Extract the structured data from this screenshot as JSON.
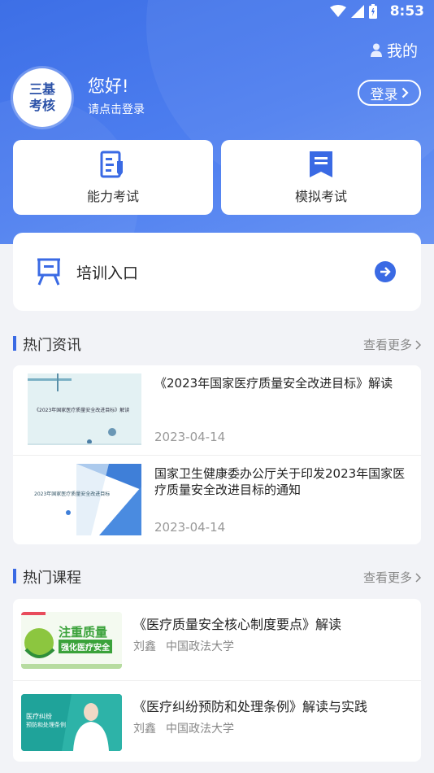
{
  "status": {
    "time": "8:53"
  },
  "header": {
    "me_label": "我的",
    "avatar_line1": "三基",
    "avatar_line2": "考核",
    "greeting": "您好!",
    "login_prompt": "请点击登录",
    "login_button": "登录"
  },
  "quick": [
    {
      "label": "能力考试",
      "icon": "exam-edit-icon"
    },
    {
      "label": "模拟考试",
      "icon": "mock-exam-icon"
    }
  ],
  "training": {
    "label": "培训入口",
    "icon": "training-board-icon"
  },
  "news": {
    "title": "热门资讯",
    "more": "查看更多",
    "items": [
      {
        "title": "《2023年国家医疗质量安全改进目标》解读",
        "date": "2023-04-14",
        "thumb_text": "《2023年国家医疗质量安全改进目标》解读"
      },
      {
        "title": "国家卫生健康委办公厅关于印发2023年国家医疗质量安全改进目标的通知",
        "date": "2023-04-14",
        "thumb_text": "2023年国家医疗质量安全改进目标"
      }
    ]
  },
  "courses": {
    "title": "热门课程",
    "more": "查看更多",
    "items": [
      {
        "title": "《医疗质量安全核心制度要点》解读",
        "author": "刘鑫",
        "org": "中国政法大学",
        "thumb_line1": "注重质量",
        "thumb_line2": "强化医疗安全"
      },
      {
        "title": "《医疗纠纷预防和处理条例》解读与实践",
        "author": "刘鑫",
        "org": "中国政法大学",
        "thumb_line1": "医疗纠纷",
        "thumb_line2": "预防和处理条例"
      }
    ]
  },
  "colors": {
    "primary": "#3a6ae4",
    "background": "#f2f3f7"
  }
}
